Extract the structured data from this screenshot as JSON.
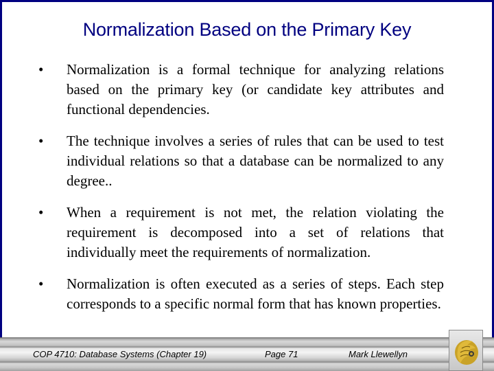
{
  "slide": {
    "title": "Normalization Based on the Primary Key",
    "bullets": [
      {
        "text": "Normalization is a formal technique for analyzing relations based on the primary key (or candidate key attributes and functional dependencies."
      },
      {
        "text": "The technique involves a series of rules that can be used to test individual relations so that a database can be normalized to any degree.."
      },
      {
        "text": "When a requirement is not met, the relation violating the requirement is decomposed into a set of relations that individually meet the requirements of normalization."
      },
      {
        "text": "Normalization is often executed as a series of steps.  Each step corresponds to a specific normal form that has known properties."
      }
    ],
    "bullet_symbol": "•"
  },
  "footer": {
    "course": "COP 4710: Database Systems  (Chapter 19)",
    "page": "Page 71",
    "author": "Mark Llewellyn",
    "logo_icon": "pegasus-logo-icon"
  },
  "colors": {
    "border": "#000080",
    "title": "#000080",
    "logo_gold": "#c9a227"
  }
}
